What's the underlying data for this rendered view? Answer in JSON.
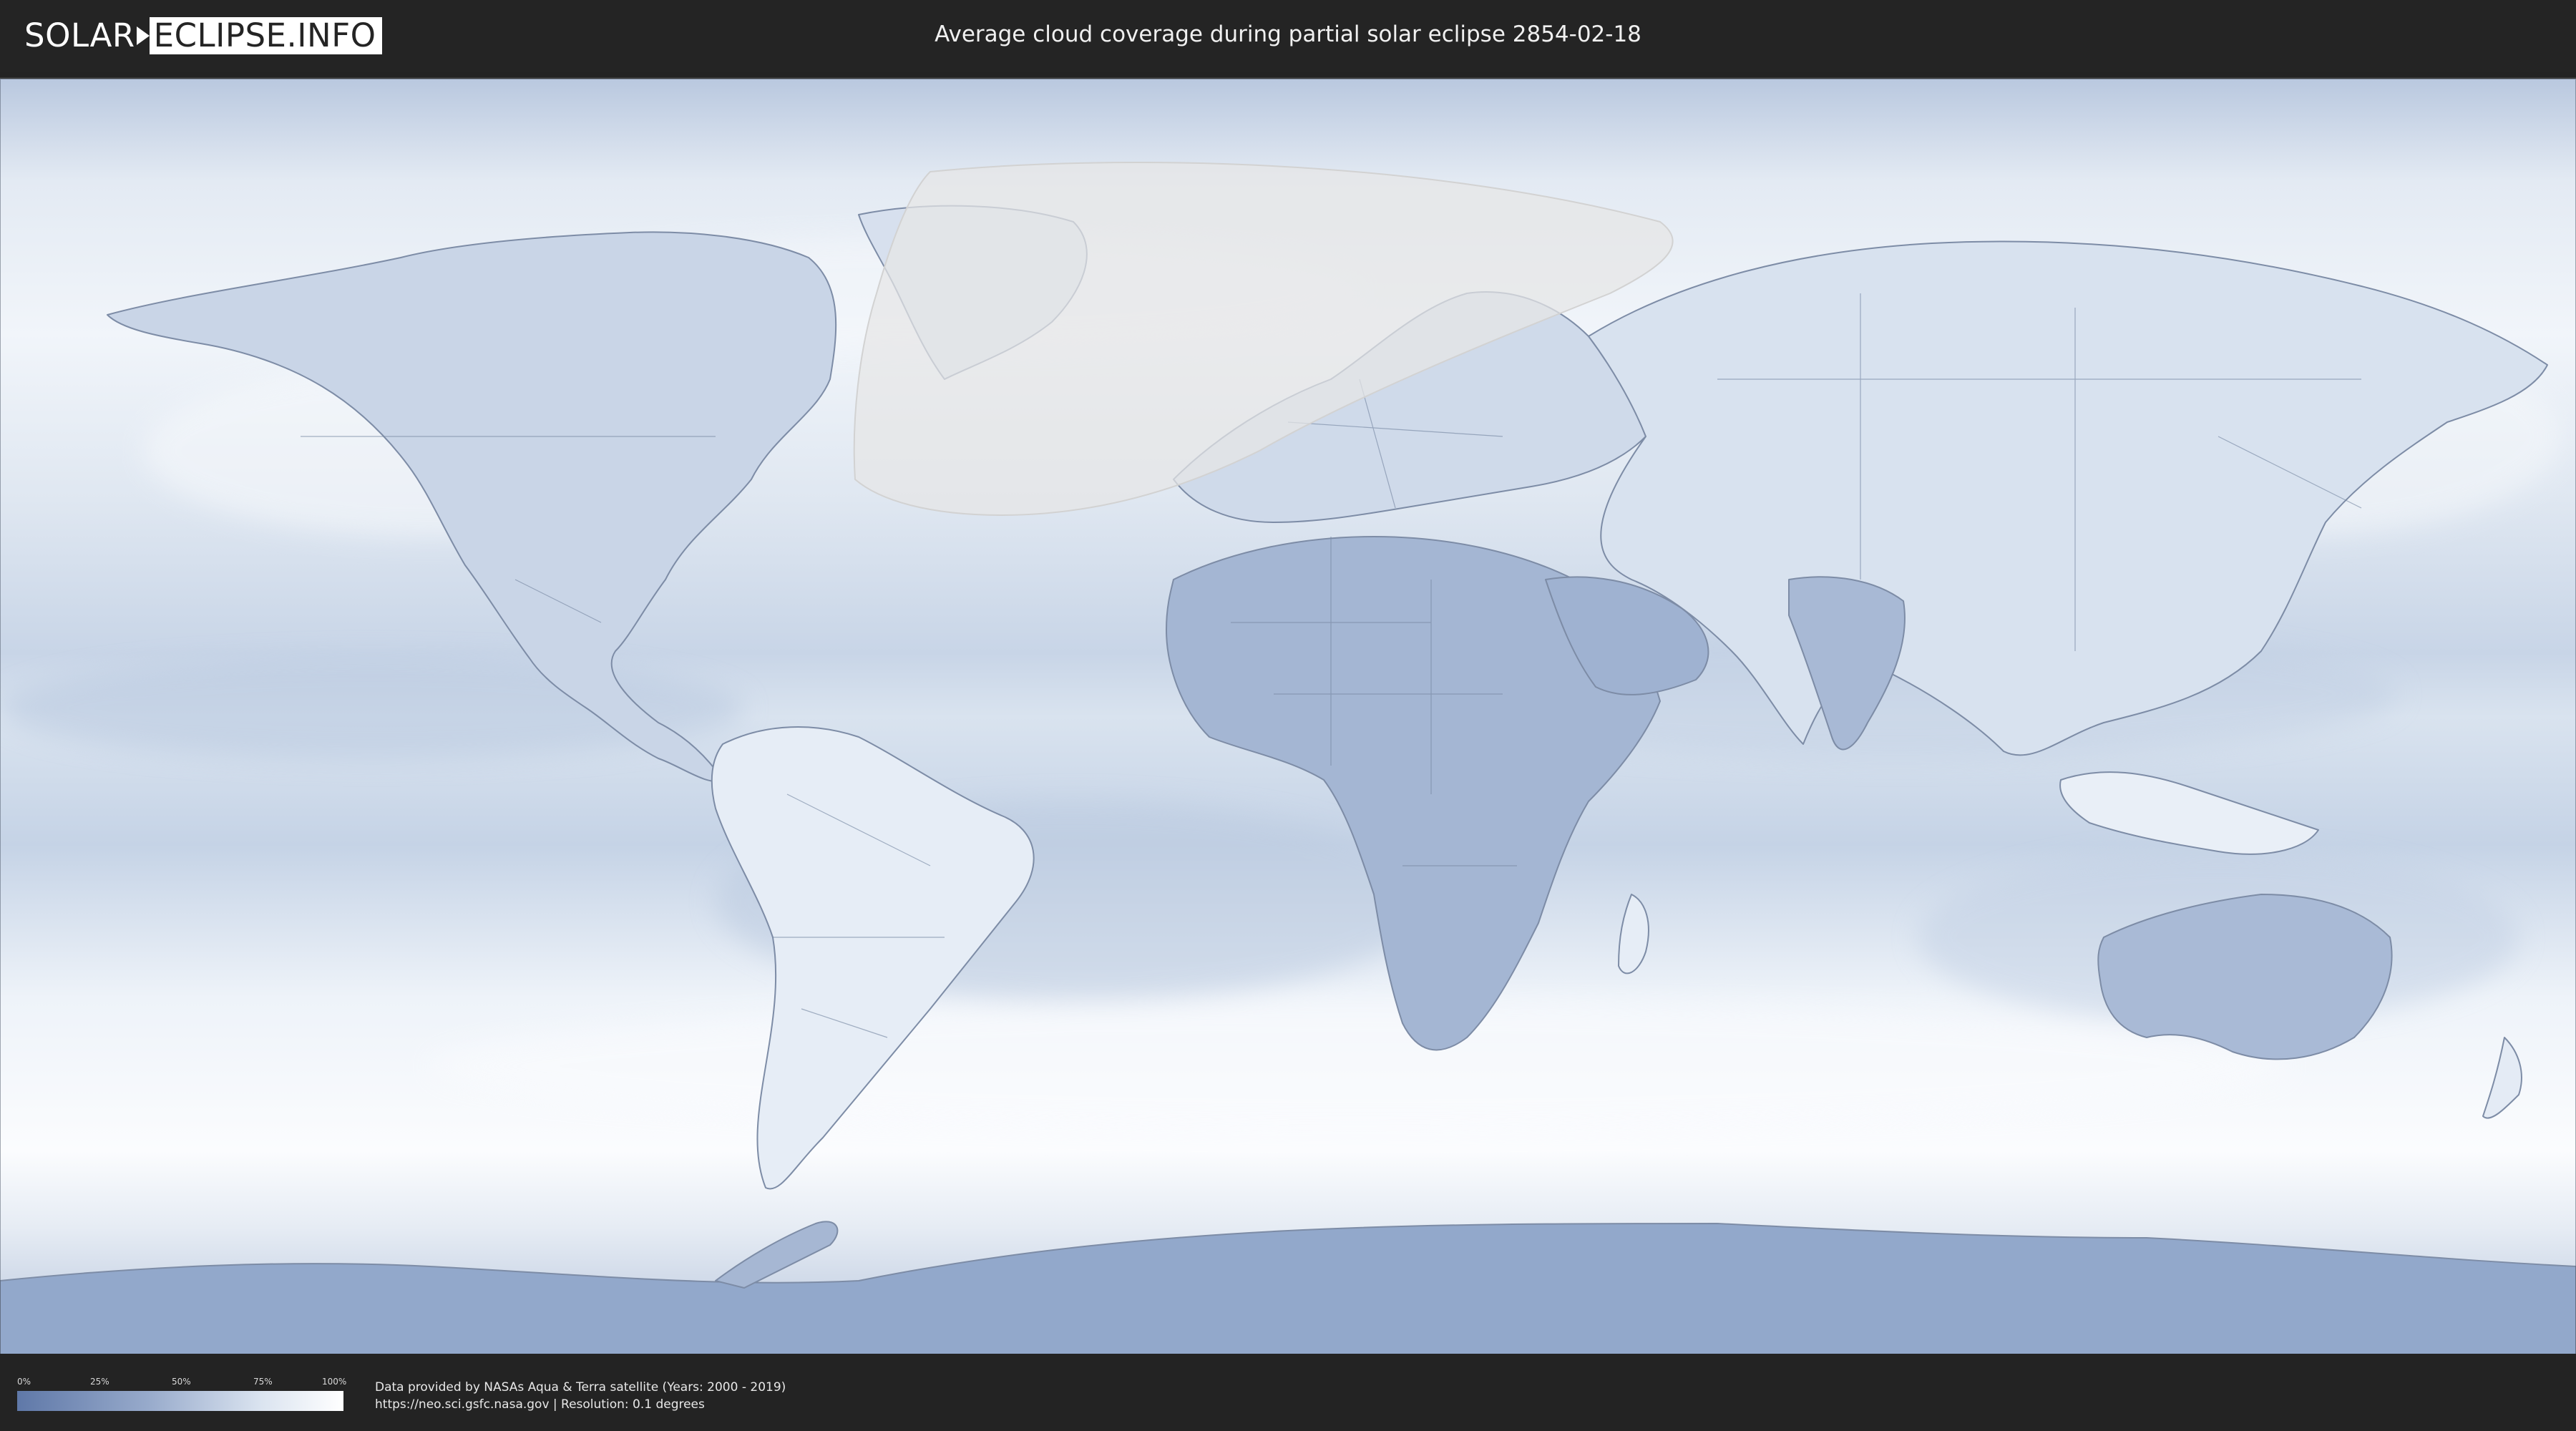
{
  "header": {
    "logo_left": "SOLAR",
    "logo_right": "ECLIPSE.INFO",
    "title": "Average cloud coverage during partial solar eclipse 2854-02-18"
  },
  "map": {
    "eclipse_overlay_color": "#e6e6e6",
    "low_cloud_color": "#5f78a8",
    "high_cloud_color": "#ffffff",
    "border_color": "#6b7a93"
  },
  "legend": {
    "ticks": [
      "0%",
      "25%",
      "50%",
      "75%",
      "100%"
    ],
    "gradient_colors": [
      "#5f78a8",
      "#97aacb",
      "#dbe4f0",
      "#ffffff"
    ]
  },
  "footer": {
    "credit_line1": "Data provided by NASAs Aqua & Terra satellite (Years: 2000 - 2019)",
    "credit_line2": "https://neo.sci.gsfc.nasa.gov | Resolution: 0.1 degrees"
  }
}
